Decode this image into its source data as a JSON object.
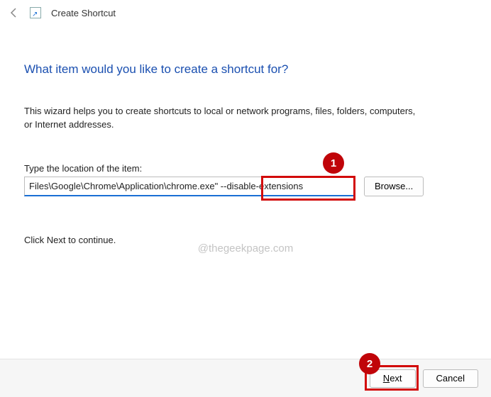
{
  "header": {
    "title": "Create Shortcut"
  },
  "heading": "What item would you like to create a shortcut for?",
  "wizard_desc": "This wizard helps you to create shortcuts to local or network programs, files, folders, computers, or Internet addresses.",
  "location": {
    "label": "Type the location of the item:",
    "value": "Files\\Google\\Chrome\\Application\\chrome.exe\" --disable-extensions",
    "browse_label": "Browse..."
  },
  "continue_text": "Click Next to continue.",
  "watermark": "@thegeekpage.com",
  "footer": {
    "next_label": "Next",
    "cancel_label": "Cancel"
  },
  "annotations": {
    "badge1": "1",
    "badge2": "2"
  }
}
